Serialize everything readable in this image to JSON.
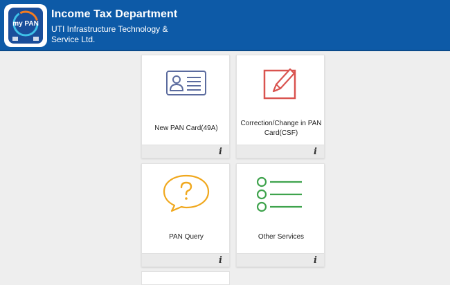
{
  "header": {
    "logo_text": "my PAN",
    "title": "Income Tax Department",
    "subtitle": "UTI Infrastructure Technology & Service Ltd."
  },
  "cards": [
    {
      "label": "New PAN Card(49A)",
      "icon": "id-card-icon",
      "color": "#5b6b9e",
      "info": "i"
    },
    {
      "label": "Correction/Change in PAN Card(CSF)",
      "icon": "edit-icon",
      "color": "#d9534f",
      "info": "i"
    },
    {
      "label": "PAN Query",
      "icon": "question-bubble-icon",
      "color": "#f0a81e",
      "info": "i"
    },
    {
      "label": "Other Services",
      "icon": "list-icon",
      "color": "#3fa34d",
      "info": "i"
    }
  ],
  "colors": {
    "header_bg": "#0d5aa7",
    "page_bg": "#eeeeee"
  }
}
